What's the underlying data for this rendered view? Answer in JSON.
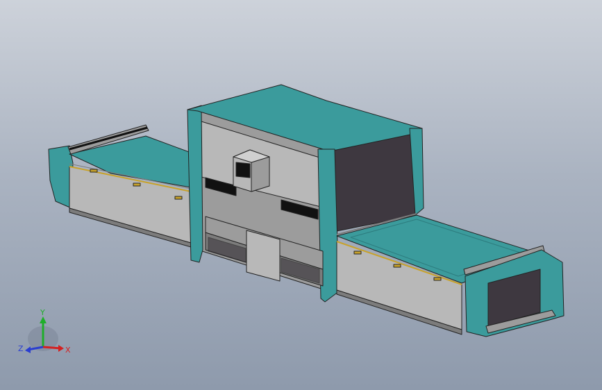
{
  "viewport": {
    "background_top": "#cdd2da",
    "background_bottom": "#8e9aac"
  },
  "model": {
    "colors": {
      "teal": "#3b9b9c",
      "teal_dark": "#2d7c7e",
      "gray_light": "#b8b8b8",
      "gray_mid": "#9c9c9c",
      "gray_dark": "#7c7c7c",
      "dark_panel": "#3e3840",
      "black": "#111111",
      "rail": "#c8a22a"
    }
  },
  "triad": {
    "y_label": "Y",
    "x_label": "X",
    "z_label": "Z",
    "y_color": "#1fae2a",
    "x_color": "#d42020",
    "z_color": "#2a3ed0"
  }
}
